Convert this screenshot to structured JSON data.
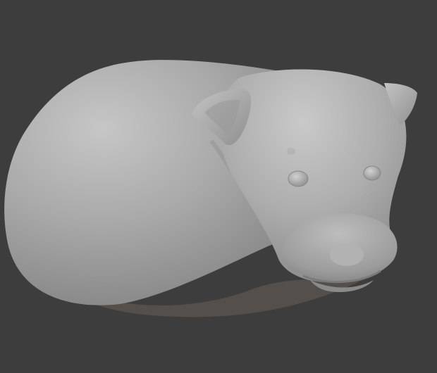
{
  "viewport": {
    "background_color": "#3d3d3d",
    "subject": "sculpted-dog-model",
    "material_base_color": "#a6a6a6",
    "highlight_color": "#c9c9c9",
    "shadow_color": "#5e5e5e",
    "contact_shadow_color": "#6a5f5a"
  }
}
